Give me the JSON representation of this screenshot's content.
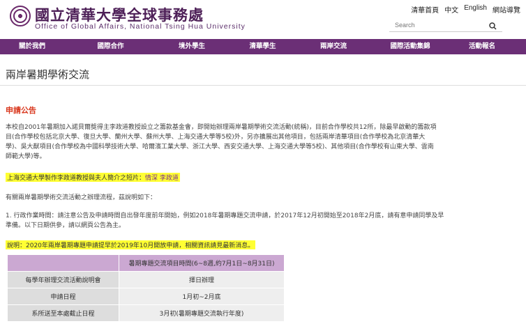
{
  "header": {
    "title_zh": "國立清華大學全球事務處",
    "title_en": "Office of Global Affairs, National Tsing Hua University",
    "links": [
      "清華首頁",
      "中文",
      "English",
      "網站導覽"
    ],
    "search_placeholder": "Search"
  },
  "nav": [
    "關於我們",
    "國際合作",
    "境外學生",
    "清華學生",
    "兩岸交流",
    "國際活動集錦",
    "活動報名"
  ],
  "page_title": "兩岸暑期學術交流",
  "notice": "申請公告",
  "intro_lines": [
    "本校自2001年暑期加入諾貝爾獎得主李政道教授設立之籌款基金會，即開始辦理兩岸暑期學術交流活動(統稱)，目前合作學校共12所，除最早啟動的籌款項",
    "目(合作學校包括北京大學、復旦大學、蘭州大學、蘇州大學、上海交通大學等5校)外，另亦擴展出其他項目，包括兩岸清華項目(合作學校為北京清華大",
    "學)、吳大猷項目(合作學校為中國科學技術大學、哈爾濱工業大學、浙江大學、西安交通大學、上海交通大學等5校)、其他項目(合作學校有山東大學、雲南",
    "師範大學)等。"
  ],
  "highlight1": {
    "text": "上海交通大學製作李政道教授與夫人簡介之短片：",
    "link": "情深 李政道"
  },
  "process_text": "有關兩岸暑期學術交流活動之辦理流程，茲說明如下：",
  "step1_lines": [
    "1. 行政作業時間：請注意公告及申請時間自出發年度前年開始，例如2018年暑期專題交流申請，於2017年12月初開始至2018年2月底，請有意申請同學及早",
    "準備。以下日期供參，請以網頁公告為主。"
  ],
  "highlight2": "說明：2020年兩岸暑期專題申請提早於2019年10月開放申請，相關資訊請見最新消息。",
  "table": {
    "header": "暑期專題交流項目時間(6~8週,約7月1日~8月31日)",
    "rows": [
      {
        "label": "每學年辦理交流活動說明會",
        "value": "擇日辦理"
      },
      {
        "label": "申請日程",
        "value": "1月初~2月底"
      },
      {
        "label": "系所送至本處截止日程",
        "value": "3月初(暑期專題交流執行年度)"
      }
    ]
  }
}
